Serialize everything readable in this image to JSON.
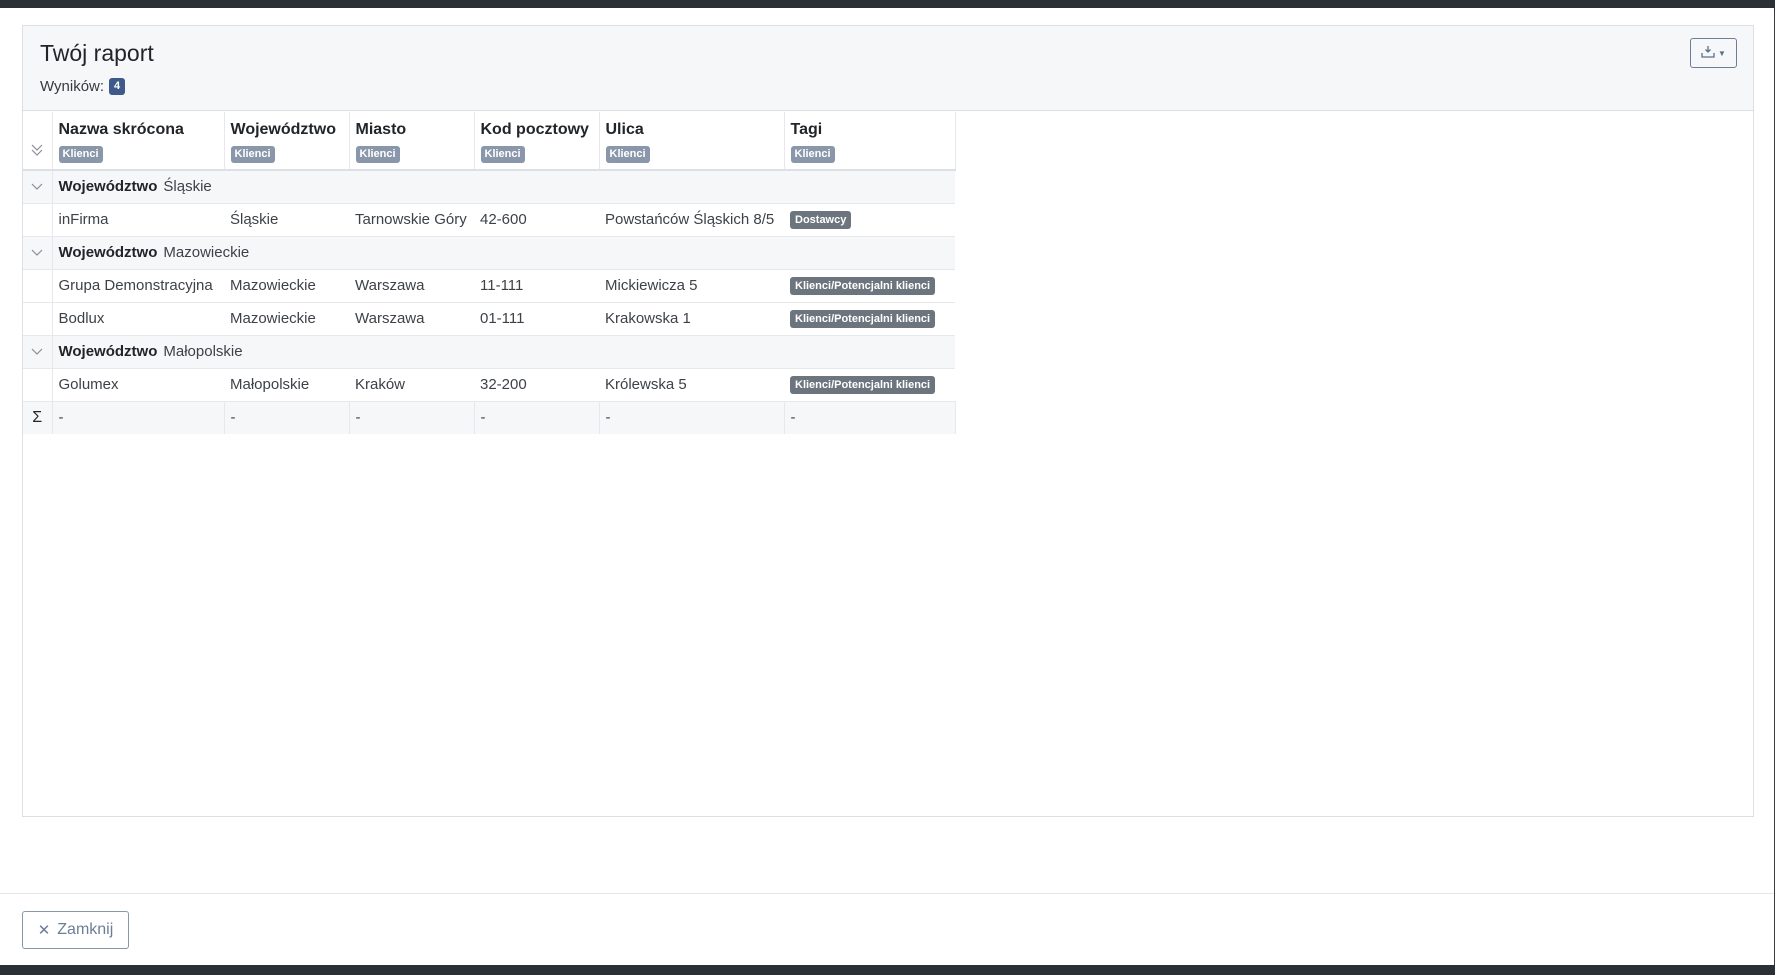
{
  "report": {
    "title": "Twój raport",
    "results_label": "Wyników:",
    "results_count": "4",
    "export_icon": "download-printer-icon"
  },
  "columns": [
    {
      "title": "Nazwa skrócona",
      "source": "Klienci"
    },
    {
      "title": "Województwo",
      "source": "Klienci"
    },
    {
      "title": "Miasto",
      "source": "Klienci"
    },
    {
      "title": "Kod pocztowy",
      "source": "Klienci"
    },
    {
      "title": "Ulica",
      "source": "Klienci"
    },
    {
      "title": "Tagi",
      "source": "Klienci"
    }
  ],
  "groups": [
    {
      "key": "Województwo",
      "value": "Śląskie",
      "rows": [
        {
          "nazwa": "inFirma",
          "woj": "Śląskie",
          "miasto": "Tarnowskie Góry",
          "kod": "42-600",
          "ulica": "Powstańców Śląskich 8/5",
          "tag": "Dostawcy"
        }
      ]
    },
    {
      "key": "Województwo",
      "value": "Mazowieckie",
      "rows": [
        {
          "nazwa": "Grupa Demonstracyjna",
          "woj": "Mazowieckie",
          "miasto": "Warszawa",
          "kod": "11-111",
          "ulica": "Mickiewicza 5",
          "tag": "Klienci/Potencjalni klienci"
        },
        {
          "nazwa": "Bodlux",
          "woj": "Mazowieckie",
          "miasto": "Warszawa",
          "kod": "01-111",
          "ulica": "Krakowska 1",
          "tag": "Klienci/Potencjalni klienci"
        }
      ]
    },
    {
      "key": "Województwo",
      "value": "Małopolskie",
      "rows": [
        {
          "nazwa": "Golumex",
          "woj": "Małopolskie",
          "miasto": "Kraków",
          "kod": "32-200",
          "ulica": "Królewska 5",
          "tag": "Klienci/Potencjalni klienci"
        }
      ]
    }
  ],
  "summary": {
    "symbol": "Σ",
    "values": [
      "-",
      "-",
      "-",
      "-",
      "-",
      "-"
    ]
  },
  "footer": {
    "close_label": "Zamknij"
  },
  "colors": {
    "count_badge": "#3f5a8a",
    "source_badge": "#8a97aa",
    "tag_badge": "#6c757d"
  }
}
